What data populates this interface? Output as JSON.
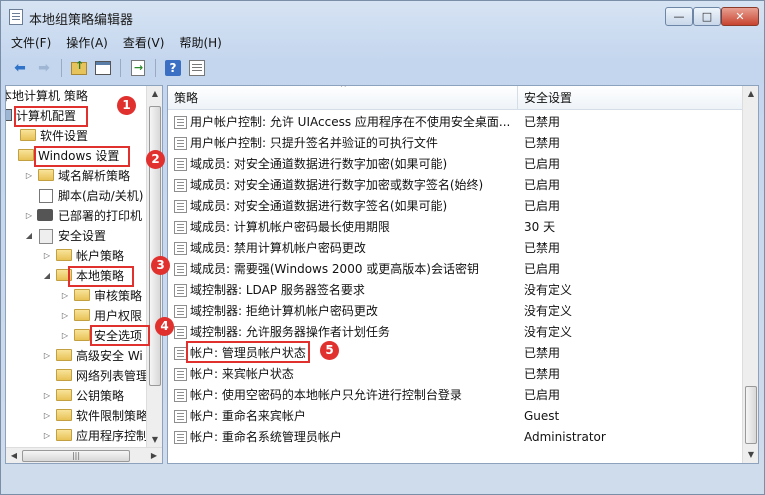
{
  "window": {
    "title": "本地组策略编辑器"
  },
  "caption": {
    "minimize": "—",
    "maximize": "□",
    "close": "✕"
  },
  "menu": [
    "文件(F)",
    "操作(A)",
    "查看(V)",
    "帮助(H)"
  ],
  "toolbar": {
    "back_icon": "arrow-left-icon",
    "forward_icon": "arrow-right-icon",
    "up_icon": "folder-up-icon",
    "console_icon": "show-hide-tree-icon",
    "export_icon": "export-list-icon",
    "help_icon": "help-icon",
    "help_glyph": "?",
    "props_icon": "properties-icon"
  },
  "tree": {
    "root": "本地计算机 策略",
    "items": [
      {
        "label": "计算机配置",
        "icon": "computer-icon",
        "expander": "",
        "level": 0
      },
      {
        "label": "软件设置",
        "icon": "folder-icon",
        "expander": "",
        "level": 1
      },
      {
        "label": "Windows 设置",
        "icon": "folder-icon",
        "expander": "◢",
        "level": 1
      },
      {
        "label": "域名解析策略",
        "icon": "folder-icon",
        "expander": "▷",
        "level": 2
      },
      {
        "label": "脚本(启动/关机)",
        "icon": "script-icon",
        "expander": "",
        "level": 2
      },
      {
        "label": "已部署的打印机",
        "icon": "printer-icon",
        "expander": "▷",
        "level": 2
      },
      {
        "label": "安全设置",
        "icon": "security-icon",
        "expander": "◢",
        "level": 2
      },
      {
        "label": "帐户策略",
        "icon": "folder-icon",
        "expander": "▷",
        "level": 3
      },
      {
        "label": "本地策略",
        "icon": "folder-icon",
        "expander": "◢",
        "level": 3
      },
      {
        "label": "审核策略",
        "icon": "folder-icon",
        "expander": "▷",
        "level": 4
      },
      {
        "label": "用户权限",
        "icon": "folder-icon",
        "expander": "▷",
        "level": 4
      },
      {
        "label": "安全选项",
        "icon": "folder-icon",
        "expander": "▷",
        "level": 4
      },
      {
        "label": "高级安全 Wi",
        "icon": "folder-icon",
        "expander": "▷",
        "level": 3
      },
      {
        "label": "网络列表管理",
        "icon": "folder-icon",
        "expander": "",
        "level": 3
      },
      {
        "label": "公钥策略",
        "icon": "folder-icon",
        "expander": "▷",
        "level": 3
      },
      {
        "label": "软件限制策略",
        "icon": "folder-icon",
        "expander": "▷",
        "level": 3
      },
      {
        "label": "应用程序控制",
        "icon": "folder-icon",
        "expander": "▷",
        "level": 3
      }
    ],
    "hscroll_grip": "|||"
  },
  "list": {
    "columns": [
      "策略",
      "安全设置"
    ],
    "sort_indicator": "^",
    "rows": [
      {
        "name": "用户帐户控制: 允许 UIAccess 应用程序在不使用安全桌面...",
        "value": "已禁用"
      },
      {
        "name": "用户帐户控制: 只提升签名并验证的可执行文件",
        "value": "已禁用"
      },
      {
        "name": "域成员: 对安全通道数据进行数字加密(如果可能)",
        "value": "已启用"
      },
      {
        "name": "域成员: 对安全通道数据进行数字加密或数字签名(始终)",
        "value": "已启用"
      },
      {
        "name": "域成员: 对安全通道数据进行数字签名(如果可能)",
        "value": "已启用"
      },
      {
        "name": "域成员: 计算机帐户密码最长使用期限",
        "value": "30 天"
      },
      {
        "name": "域成员: 禁用计算机帐户密码更改",
        "value": "已禁用"
      },
      {
        "name": "域成员: 需要强(Windows 2000 或更高版本)会话密钥",
        "value": "已启用"
      },
      {
        "name": "域控制器: LDAP 服务器签名要求",
        "value": "没有定义"
      },
      {
        "name": "域控制器: 拒绝计算机帐户密码更改",
        "value": "没有定义"
      },
      {
        "name": "域控制器: 允许服务器操作者计划任务",
        "value": "没有定义"
      },
      {
        "name": "帐户: 管理员帐户状态",
        "value": "已禁用"
      },
      {
        "name": "帐户: 来宾帐户状态",
        "value": "已禁用"
      },
      {
        "name": "帐户: 使用空密码的本地帐户只允许进行控制台登录",
        "value": "已启用"
      },
      {
        "name": "帐户: 重命名来宾帐户",
        "value": "Guest"
      },
      {
        "name": "帐户: 重命名系统管理员帐户",
        "value": "Administrator"
      }
    ]
  },
  "annotations": {
    "badges": [
      "1",
      "2",
      "3",
      "4",
      "5"
    ],
    "color": "#e0312e"
  }
}
